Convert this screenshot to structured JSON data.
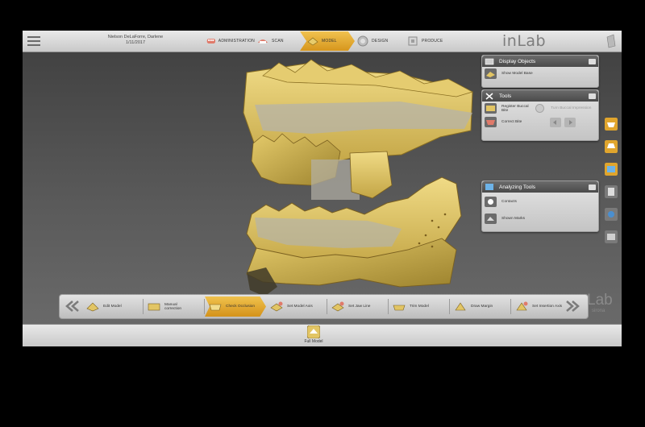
{
  "patient": {
    "name": "Nielson DeLaForre, Darlene",
    "date": "1/11/2017"
  },
  "steps": [
    {
      "label": "ADMINISTRATION",
      "icon": "teeth-icon"
    },
    {
      "label": "SCAN",
      "icon": "scan-icon"
    },
    {
      "label": "MODEL",
      "icon": "model-icon",
      "active": true
    },
    {
      "label": "DESIGN",
      "icon": "design-icon"
    },
    {
      "label": "PRODUCE",
      "icon": "produce-icon"
    }
  ],
  "brand": {
    "logo": "inLab",
    "bottom_logo": "Lab",
    "sub": "sirona"
  },
  "panels": {
    "display_objects": {
      "title": "Display Objects",
      "items": [
        "Show Model Base"
      ]
    },
    "tools": {
      "title": "Tools",
      "register": "Register Buccal Bite",
      "turn": "Turn Buccal Impression",
      "correct": "Correct Bite"
    },
    "analyzing": {
      "title": "Analyzing Tools",
      "items": [
        "Contacts",
        "Shown Marks"
      ]
    }
  },
  "toolbar": {
    "items": [
      {
        "label": "Edit Model"
      },
      {
        "label": "Manual correction"
      },
      {
        "label": "Check Occlusion",
        "active": true
      },
      {
        "label": "Set Model Axis"
      },
      {
        "label": "Set Jaw Line"
      },
      {
        "label": "Trim Model"
      },
      {
        "label": "Draw Margin"
      },
      {
        "label": "Set Insertion Axis"
      }
    ]
  },
  "bottom": {
    "label": "Full Model"
  },
  "colors": {
    "accent": "#e0a52d",
    "tooth": "#dcc264",
    "tooth_dark": "#a58b34",
    "gray_overlay": "#b5b3a8"
  }
}
